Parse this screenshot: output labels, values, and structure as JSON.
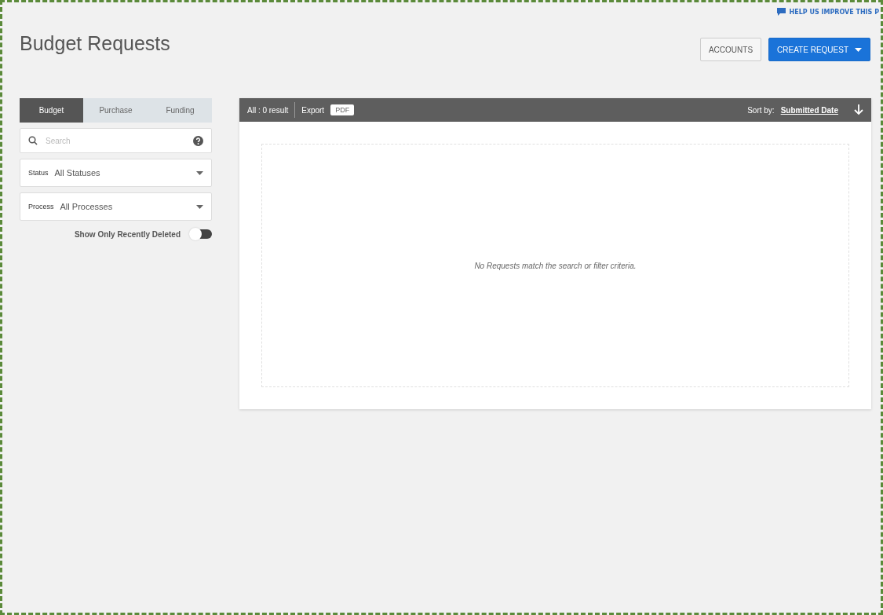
{
  "help_link": "HELP US IMPROVE THIS P",
  "title": "Budget Requests",
  "header_buttons": [
    {
      "label": "ACCOUNTS",
      "kind": "secondary"
    },
    {
      "label": "CREATE REQUEST",
      "kind": "primary"
    }
  ],
  "tabs": [
    {
      "label": "Budget",
      "selected": true
    },
    {
      "label": "Purchase",
      "selected": false
    },
    {
      "label": "Funding",
      "selected": false
    }
  ],
  "search": {
    "placeholder": "Search"
  },
  "filters": [
    {
      "label": "Status",
      "value": "All Statuses"
    },
    {
      "label": "Process",
      "value": "All Processes"
    }
  ],
  "toggle": {
    "label": "Show Only Recently Deleted",
    "on": false
  },
  "results": {
    "count": "All : 0 result",
    "export_label": "Export",
    "export_button": "PDF",
    "sort_label": "Sort by:",
    "sort_value": "Submitted Date",
    "empty_message": "No Requests match the search or filter criteria."
  }
}
